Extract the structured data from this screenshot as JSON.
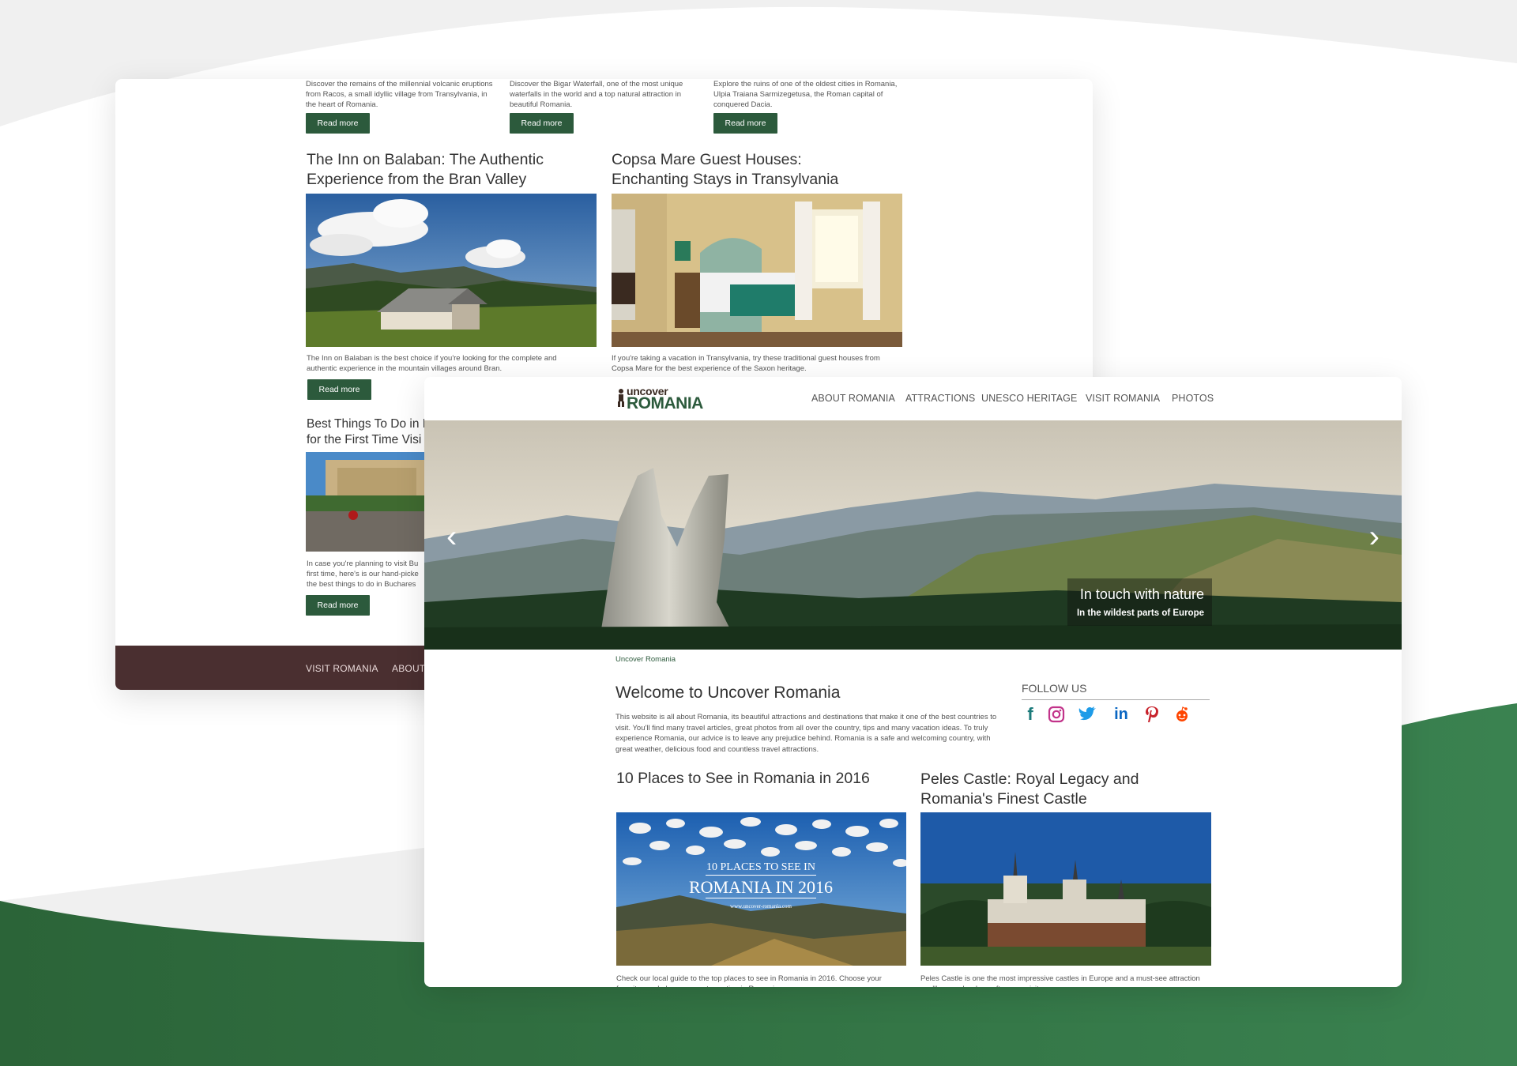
{
  "back_page": {
    "top_posts": [
      {
        "excerpt": "Discover the remains of the millennial volcanic eruptions from Racos, a small idyllic village from Transylvania, in the heart of Romania.",
        "button": "Read more"
      },
      {
        "excerpt": "Discover the Bigar Waterfall, one of the most unique waterfalls in the world and a top natural attraction in beautiful Romania.",
        "button": "Read more"
      },
      {
        "excerpt": "Explore the ruins of one of the oldest cities in Romania, Ulpia Traiana Sarmizegetusa, the Roman capital of conquered Dacia.",
        "button": "Read more"
      }
    ],
    "posts": [
      {
        "title": "The Inn on Balaban: The Authentic Experience from the Bran Valley",
        "excerpt": "The Inn on Balaban is the best choice if you're looking for the complete and authentic experience in the mountain villages around Bran.",
        "button": "Read more"
      },
      {
        "title": "Copsa Mare Guest Houses: Enchanting Stays in Transylvania",
        "excerpt": "If you're taking a vacation in Transylvania, try these traditional guest houses from Copsa Mare for the best experience of the Saxon heritage."
      },
      {
        "title": "Best Things To Do in B",
        "title2": "for the First Time Visi",
        "excerpt1": "In case you're planning to visit Bu",
        "excerpt2": "first time, here's is our hand-picke",
        "excerpt3": "the best things to do in Buchares",
        "button": "Read more"
      }
    ],
    "footer": {
      "visit": "VISIT ROMANIA",
      "about": "ABOUT"
    }
  },
  "front_page": {
    "logo": {
      "top": "uncover",
      "bottom": "ROMANIA"
    },
    "nav": [
      "ABOUT ROMANIA",
      "ATTRACTIONS",
      "UNESCO HERITAGE",
      "VISIT ROMANIA",
      "PHOTOS"
    ],
    "hero": {
      "title": "In touch with nature",
      "subtitle": "In the wildest parts of Europe"
    },
    "breadcrumb": "Uncover Romania",
    "welcome": {
      "title": "Welcome to Uncover Romania",
      "text": "This website is all about Romania, its beautiful attractions and destinations that make it one of the best countries to visit. You'll find many travel articles, great photos from all over the country, tips and many vacation ideas. To truly experience Romania, our advice is to leave any prejudice behind. Romania is a safe and welcoming country, with great weather, delicious food and countless travel attractions."
    },
    "follow": {
      "title": "FOLLOW US",
      "icons": [
        "facebook-icon",
        "instagram-icon",
        "twitter-icon",
        "linkedin-icon",
        "pinterest-icon",
        "reddit-icon"
      ]
    },
    "posts": [
      {
        "title": "10 Places to See in Romania in 2016",
        "img_line1": "10 PLACES TO SEE IN",
        "img_line2": "ROMANIA IN 2016",
        "img_line3": "www.uncover-romania.com",
        "excerpt": "Check our local guide to the top places to see in Romania in 2016. Choose your favorites and plan your next vacation in Romania."
      },
      {
        "title": "Peles Castle: Royal Legacy and Romania's Finest Castle",
        "excerpt": "Peles Castle is one the most impressive castles in Europe and a must-see attraction you'll remember long after your visit."
      }
    ]
  },
  "colors": {
    "brand_green": "#2c5a3c",
    "footer_brown": "#4a2f30",
    "bg_green": "#3a7a4a"
  }
}
